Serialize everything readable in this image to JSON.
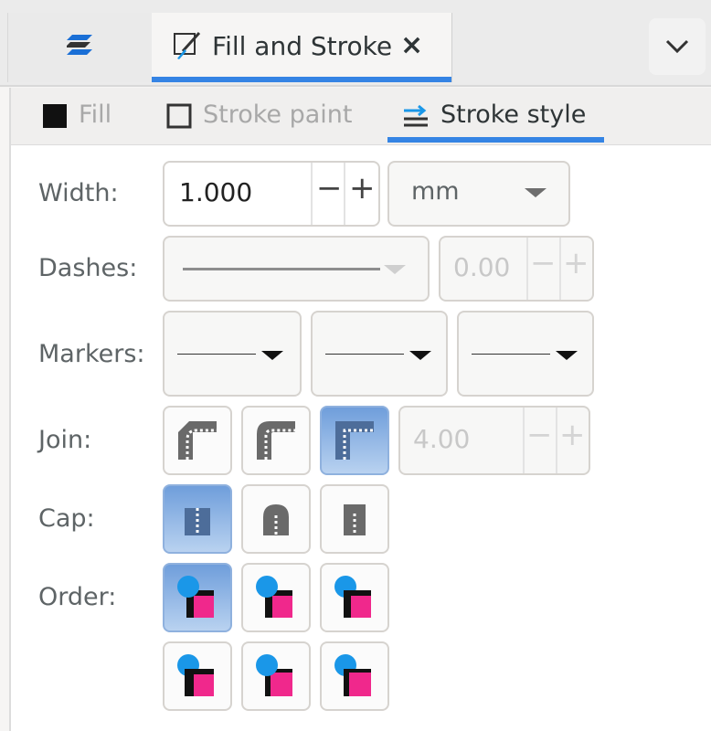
{
  "dock": {
    "tab_title": "Fill and Stroke",
    "close_glyph": "×",
    "left_tab_icon": "dock-stack-icon",
    "dropdown_icon": "chevron-down-icon",
    "accent": "#3584e4"
  },
  "subtabs": [
    {
      "label": "Fill",
      "icon": "fill-square-icon",
      "active": false
    },
    {
      "label": "Stroke paint",
      "icon": "stroke-square-icon",
      "active": false
    },
    {
      "label": "Stroke style",
      "icon": "stroke-style-icon",
      "active": true
    }
  ],
  "width": {
    "label": "Width:",
    "value": "1.000",
    "minus": "−",
    "plus": "+",
    "unit": "mm"
  },
  "dashes": {
    "label": "Dashes:",
    "offset": "0.00",
    "minus": "−",
    "plus": "+"
  },
  "markers": {
    "label": "Markers:"
  },
  "join": {
    "label": "Join:",
    "options": [
      "bevel-join-icon",
      "round-join-icon",
      "miter-join-icon"
    ],
    "selected": 2,
    "miter_limit": "4.00",
    "minus": "−",
    "plus": "+"
  },
  "cap": {
    "label": "Cap:",
    "options": [
      "butt-cap-icon",
      "round-cap-icon",
      "square-cap-icon"
    ],
    "selected": 0
  },
  "order": {
    "label": "Order:",
    "selected": 0,
    "colors": {
      "marker": "#1a97e8",
      "stroke": "#111111",
      "fill": "#f0288c"
    }
  }
}
